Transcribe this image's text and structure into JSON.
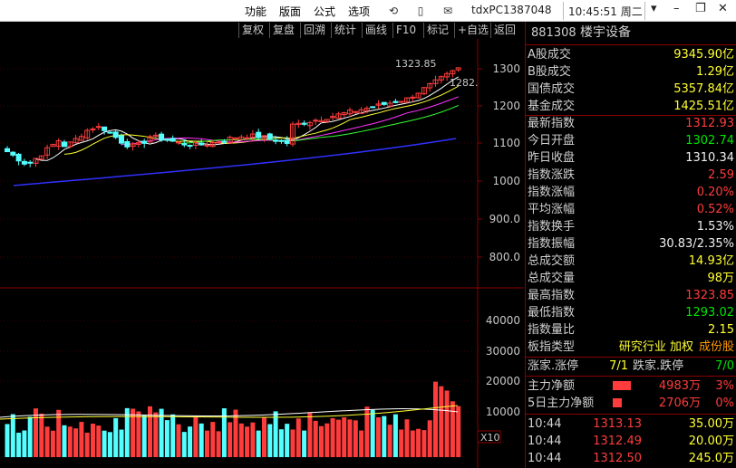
{
  "menu": [
    "功能",
    "版面",
    "公式",
    "选项"
  ],
  "host": "tdxPC1387048",
  "clock": "10:45:51 周二",
  "toolbar": [
    "复权",
    "复盘",
    "回溯",
    "统计",
    "画线",
    "F10",
    "标记",
    "+自选",
    "返回"
  ],
  "chart": {
    "price_axis": [
      "1300",
      "1200",
      "1100",
      "1000",
      "900.0",
      "800.0"
    ],
    "vol_axis": [
      "40000",
      "30000",
      "20000",
      "10000"
    ],
    "high_label": "1323.85",
    "last_label": "1282.",
    "vol_unit": "X10"
  },
  "panel": {
    "code": "881308",
    "name": "楼宇设备",
    "rows": [
      {
        "k": "A股成交",
        "v": "9345.90亿",
        "c": "yel"
      },
      {
        "k": "B股成交",
        "v": "1.29亿",
        "c": "yel"
      },
      {
        "k": "国债成交",
        "v": "5357.84亿",
        "c": "yel"
      },
      {
        "k": "基金成交",
        "v": "1425.51亿",
        "c": "yel"
      },
      {
        "k": "最新指数",
        "v": "1312.93",
        "c": "red"
      },
      {
        "k": "今日开盘",
        "v": "1302.74",
        "c": "grn"
      },
      {
        "k": "昨日收盘",
        "v": "1310.34",
        "c": "wht"
      },
      {
        "k": "指数涨跌",
        "v": "2.59",
        "c": "red"
      },
      {
        "k": "指数涨幅",
        "v": "0.20%",
        "c": "red"
      },
      {
        "k": "平均涨幅",
        "v": "0.52%",
        "c": "red"
      },
      {
        "k": "指数换手",
        "v": "1.53%",
        "c": "wht"
      },
      {
        "k": "指数振幅",
        "v": "30.83/2.35%",
        "c": "wht"
      },
      {
        "k": "总成交额",
        "v": "14.93亿",
        "c": "yel"
      },
      {
        "k": "总成交量",
        "v": "98万",
        "c": "yel"
      },
      {
        "k": "最高指数",
        "v": "1323.85",
        "c": "red"
      },
      {
        "k": "最低指数",
        "v": "1293.02",
        "c": "grn"
      },
      {
        "k": "指数量比",
        "v": "2.15",
        "c": "yel"
      }
    ],
    "type_label": "板指类型",
    "type_value": "研究行业 加权",
    "type_link": "成份股",
    "limit": {
      "up_label": "涨家.涨停",
      "up_val": "7/1",
      "down_label": "跌家.跌停",
      "down_val": "7/0"
    },
    "flow": [
      {
        "k": "主力净额",
        "v": "4983万",
        "p": "3%"
      },
      {
        "k": "5日主力净额",
        "v": "2706万",
        "p": "0%"
      }
    ],
    "ticks": [
      {
        "t": "10:44",
        "p": "1313.13",
        "v": "35.00万"
      },
      {
        "t": "10:44",
        "p": "1312.49",
        "v": "20.00万"
      },
      {
        "t": "10:44",
        "p": "1312.50",
        "v": "245.0万"
      }
    ]
  }
}
